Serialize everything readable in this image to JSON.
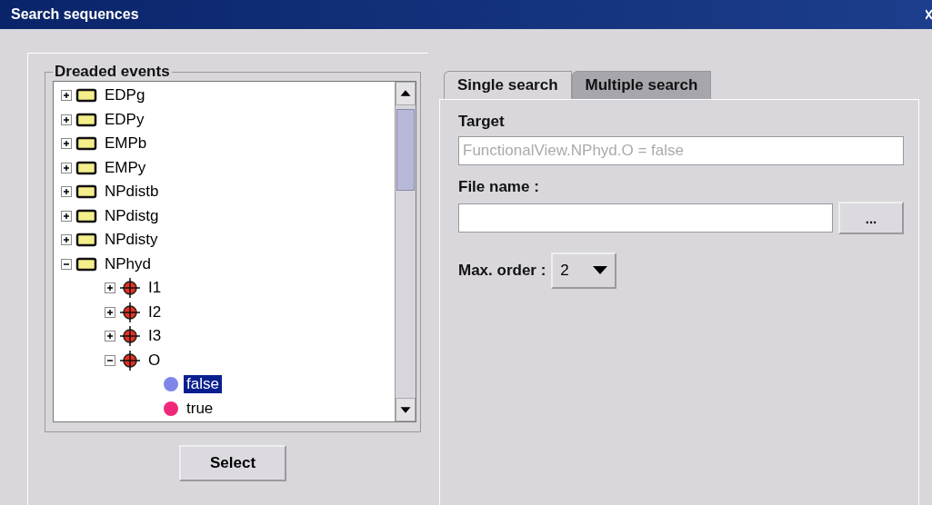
{
  "window": {
    "title": "Search sequences"
  },
  "tree": {
    "title": "Dreaded events",
    "nodes": [
      {
        "kind": "folder",
        "label": "EDPg",
        "expanded": false,
        "selected": false
      },
      {
        "kind": "folder",
        "label": "EDPy",
        "expanded": false,
        "selected": false
      },
      {
        "kind": "folder",
        "label": "EMPb",
        "expanded": false,
        "selected": false
      },
      {
        "kind": "folder",
        "label": "EMPy",
        "expanded": false,
        "selected": false
      },
      {
        "kind": "folder",
        "label": "NPdistb",
        "expanded": false,
        "selected": false
      },
      {
        "kind": "folder",
        "label": "NPdistg",
        "expanded": false,
        "selected": false
      },
      {
        "kind": "folder",
        "label": "NPdisty",
        "expanded": false,
        "selected": false
      },
      {
        "kind": "folder",
        "label": "NPhyd",
        "expanded": true,
        "selected": false,
        "children": [
          {
            "kind": "target",
            "label": "I1",
            "expanded": false,
            "selected": false
          },
          {
            "kind": "target",
            "label": "I2",
            "expanded": false,
            "selected": false
          },
          {
            "kind": "target",
            "label": "I3",
            "expanded": false,
            "selected": false
          },
          {
            "kind": "target",
            "label": "O",
            "expanded": true,
            "selected": false,
            "children": [
              {
                "kind": "value",
                "label": "false",
                "color": "#7f86e8",
                "selected": true
              },
              {
                "kind": "value",
                "label": "true",
                "color": "#f0287a",
                "selected": false
              }
            ]
          }
        ]
      }
    ]
  },
  "select_button": "Select",
  "tabs": [
    {
      "label": "Single search",
      "selected": true
    },
    {
      "label": "Multiple search",
      "selected": false
    }
  ],
  "target": {
    "label": "Target",
    "value": "FunctionalView.NPhyd.O = false",
    "disabled": true
  },
  "file_name": {
    "label": "File name :",
    "browse_button": "..."
  },
  "max_order": {
    "label": "Max. order :",
    "value": "2"
  }
}
